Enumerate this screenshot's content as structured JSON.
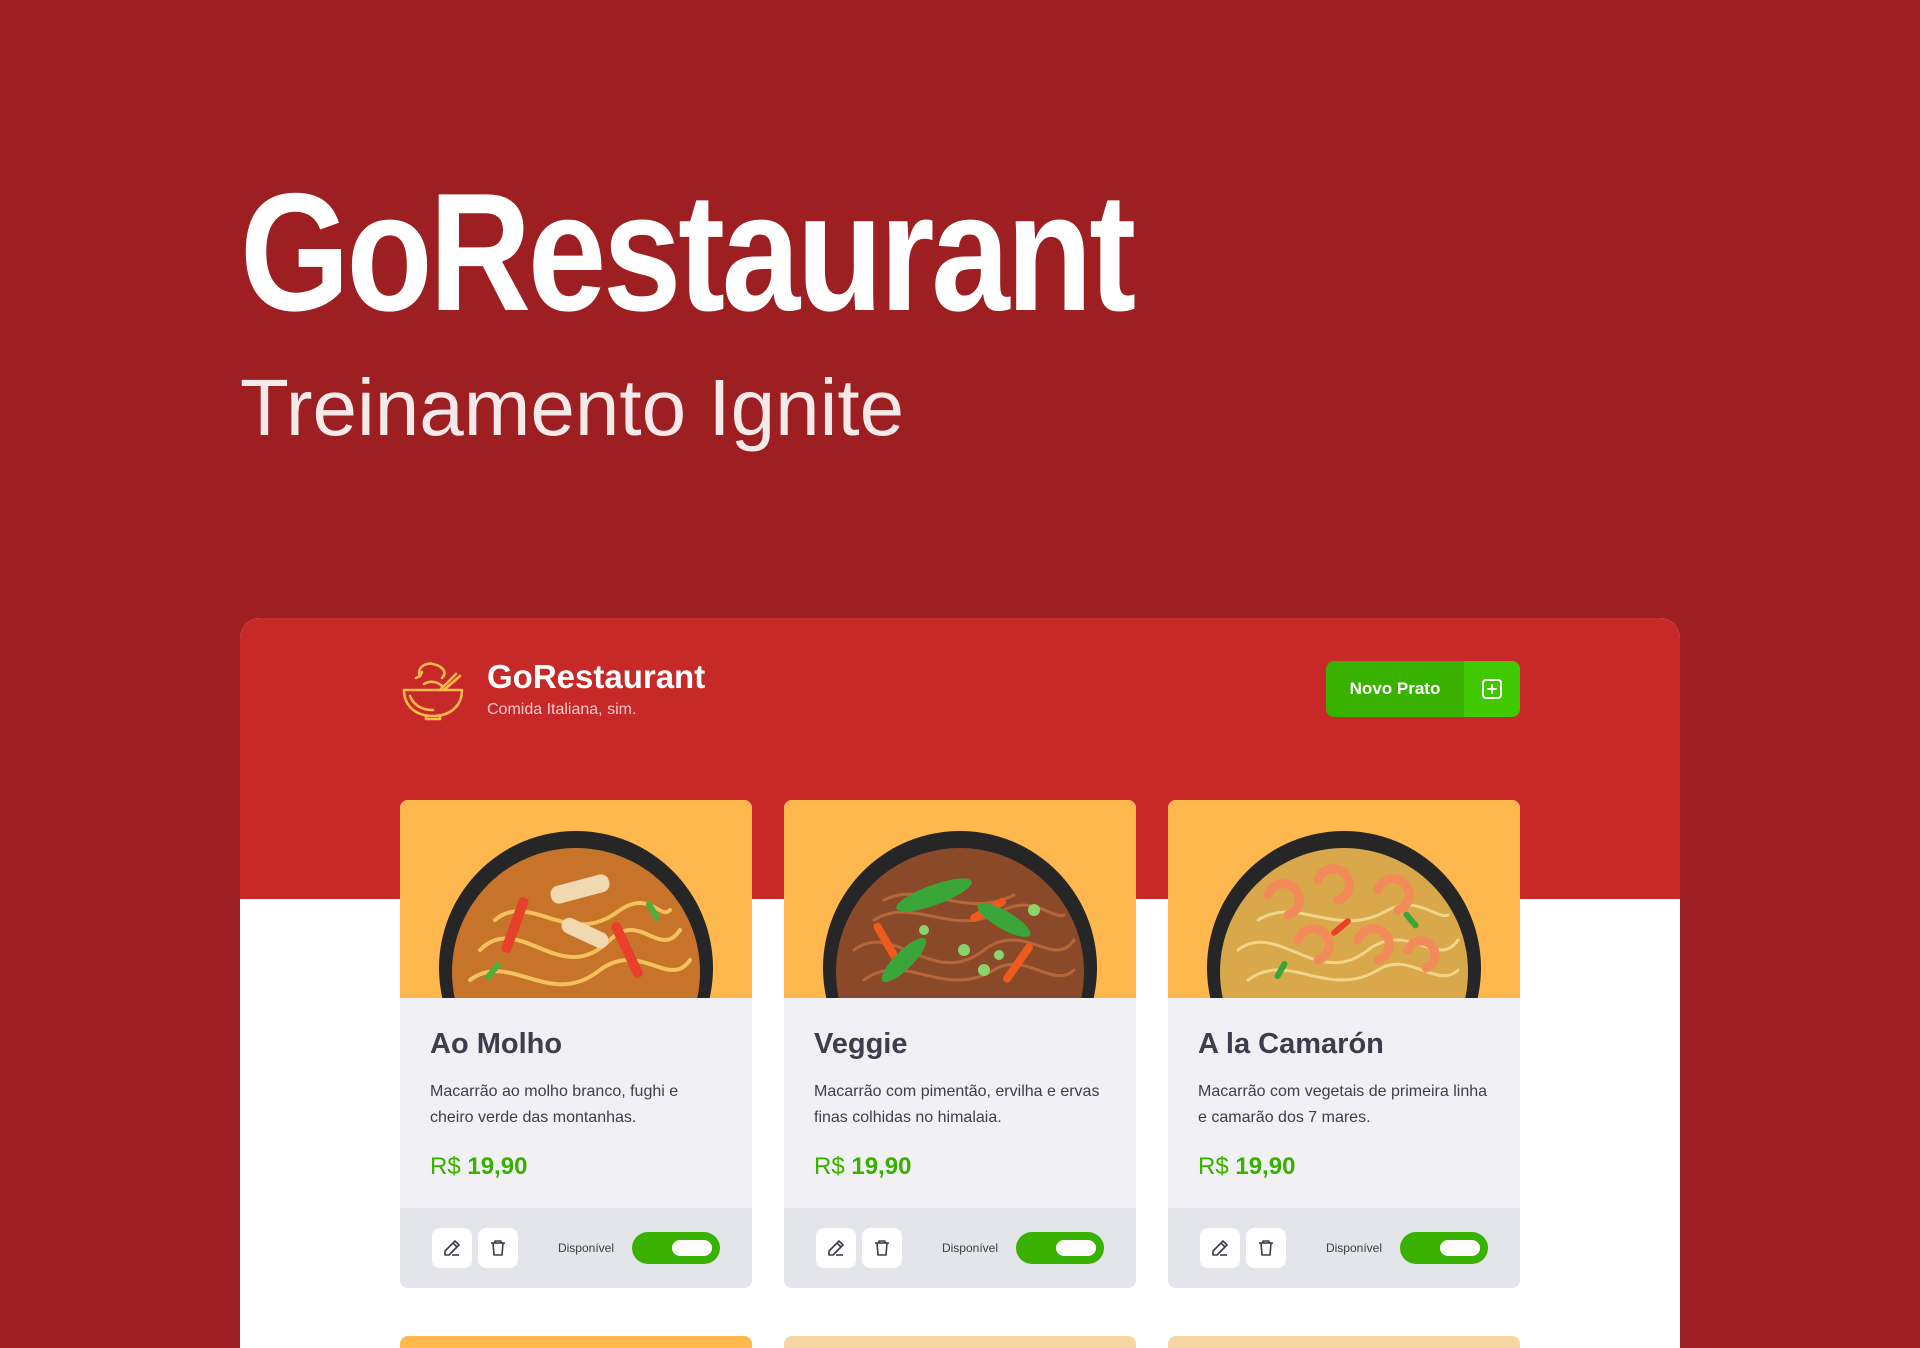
{
  "hero": {
    "title": "GoRestaurant",
    "subtitle": "Treinamento Ignite"
  },
  "header": {
    "brand_name": "GoRestaurant",
    "tagline": "Comida Italiana, sim.",
    "new_dish_label": "Novo Prato",
    "new_dish_icon": "plus-square-icon"
  },
  "colors": {
    "page_bg": "#9e1f22",
    "header_bg": "#c72828",
    "accent_green": "#39b100",
    "card_image_bg": "#ffb84d"
  },
  "dishes": [
    {
      "name": "Ao Molho",
      "description": "Macarrão ao molho branco, fughi e cheiro verde das montanhas.",
      "currency": "R$",
      "price": "19,90",
      "available_label": "Disponível",
      "available": true
    },
    {
      "name": "Veggie",
      "description": "Macarrão com pimentão, ervilha e ervas finas colhidas no himalaia.",
      "currency": "R$",
      "price": "19,90",
      "available_label": "Disponível",
      "available": true
    },
    {
      "name": "A la Camarón",
      "description": "Macarrão com vegetais de primeira linha e camarão dos 7 mares.",
      "currency": "R$",
      "price": "19,90",
      "available_label": "Disponível",
      "available": true
    }
  ]
}
